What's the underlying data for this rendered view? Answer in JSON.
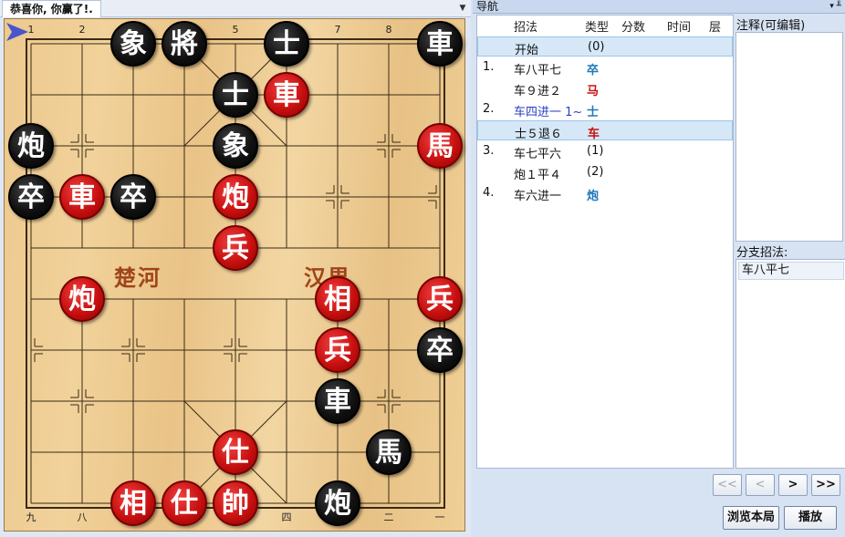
{
  "status_tab": {
    "title": "恭喜你, 你赢了!.",
    "menu_icon": "triangle-down-icon"
  },
  "board": {
    "top_files": [
      "1",
      "2",
      "3",
      "4",
      "5",
      "6",
      "7",
      "8",
      "9"
    ],
    "bottom_files": [
      "九",
      "八",
      "七",
      "六",
      "五",
      "四",
      "三",
      "二",
      "一"
    ],
    "river_left": "楚河",
    "river_right": "汉界",
    "pieces": [
      {
        "char": "象",
        "side": "black",
        "file": 3,
        "rank": 0
      },
      {
        "char": "將",
        "side": "black",
        "file": 4,
        "rank": 0
      },
      {
        "char": "士",
        "side": "black",
        "file": 6,
        "rank": 0
      },
      {
        "char": "車",
        "side": "black",
        "file": 9,
        "rank": 0
      },
      {
        "char": "士",
        "side": "black",
        "file": 5,
        "rank": 1
      },
      {
        "char": "車",
        "side": "red",
        "file": 6,
        "rank": 1
      },
      {
        "char": "炮",
        "side": "black",
        "file": 1,
        "rank": 2
      },
      {
        "char": "象",
        "side": "black",
        "file": 5,
        "rank": 2
      },
      {
        "char": "馬",
        "side": "red",
        "file": 9,
        "rank": 2
      },
      {
        "char": "卒",
        "side": "black",
        "file": 1,
        "rank": 3
      },
      {
        "char": "車",
        "side": "red",
        "file": 2,
        "rank": 3
      },
      {
        "char": "卒",
        "side": "black",
        "file": 3,
        "rank": 3
      },
      {
        "char": "炮",
        "side": "red",
        "file": 5,
        "rank": 3
      },
      {
        "char": "兵",
        "side": "red",
        "file": 5,
        "rank": 4
      },
      {
        "char": "炮",
        "side": "red",
        "file": 2,
        "rank": 5
      },
      {
        "char": "相",
        "side": "red",
        "file": 7,
        "rank": 5
      },
      {
        "char": "兵",
        "side": "red",
        "file": 9,
        "rank": 5
      },
      {
        "char": "兵",
        "side": "red",
        "file": 7,
        "rank": 6
      },
      {
        "char": "卒",
        "side": "black",
        "file": 9,
        "rank": 6
      },
      {
        "char": "車",
        "side": "black",
        "file": 7,
        "rank": 7
      },
      {
        "char": "仕",
        "side": "red",
        "file": 5,
        "rank": 8
      },
      {
        "char": "馬",
        "side": "black",
        "file": 8,
        "rank": 8
      },
      {
        "char": "相",
        "side": "red",
        "file": 3,
        "rank": 9
      },
      {
        "char": "仕",
        "side": "red",
        "file": 4,
        "rank": 9
      },
      {
        "char": "帥",
        "side": "red",
        "file": 5,
        "rank": 9
      },
      {
        "char": "炮",
        "side": "black",
        "file": 7,
        "rank": 9
      }
    ]
  },
  "navigator": {
    "title": "导航",
    "header_icons": "▾ ╨",
    "columns": {
      "move": "招法",
      "type": "类型",
      "score": "分数",
      "time": "时间",
      "depth": "层"
    },
    "rows": [
      {
        "num": "",
        "move": "开始",
        "type": "(0)",
        "type_color": "#111111",
        "move_color": "#111111",
        "selected": true
      },
      {
        "num": "1.",
        "move": "车八平七",
        "type": "卒",
        "type_color": "#1f7ab8",
        "move_color": "#111111",
        "selected": false
      },
      {
        "num": "",
        "move": "车９进２",
        "type": "马",
        "type_color": "#c81010",
        "move_color": "#111111",
        "selected": false
      },
      {
        "num": "2.",
        "move": "车四进一 1~",
        "type": "士",
        "type_color": "#1f7ab8",
        "move_color": "#2a3fc0",
        "selected": false
      },
      {
        "num": "",
        "move": "士５退６",
        "type": "车",
        "type_color": "#c81010",
        "move_color": "#111111",
        "selected": true
      },
      {
        "num": "3.",
        "move": "车七平六",
        "type": "(1)",
        "type_color": "#111111",
        "move_color": "#111111",
        "selected": false
      },
      {
        "num": "",
        "move": "炮１平４",
        "type": "(2)",
        "type_color": "#111111",
        "move_color": "#111111",
        "selected": false
      },
      {
        "num": "4.",
        "move": "车六进一",
        "type": "炮",
        "type_color": "#1f7ab8",
        "move_color": "#111111",
        "selected": false
      }
    ]
  },
  "comment_label": "注释(可编辑)",
  "branch_label": "分支招法:",
  "branch_items": [
    "车八平七"
  ],
  "nav_buttons": {
    "first": "<<",
    "prev": "<",
    "next": ">",
    "last": ">>"
  },
  "browse_button": "浏览本局",
  "play_button": "播放"
}
